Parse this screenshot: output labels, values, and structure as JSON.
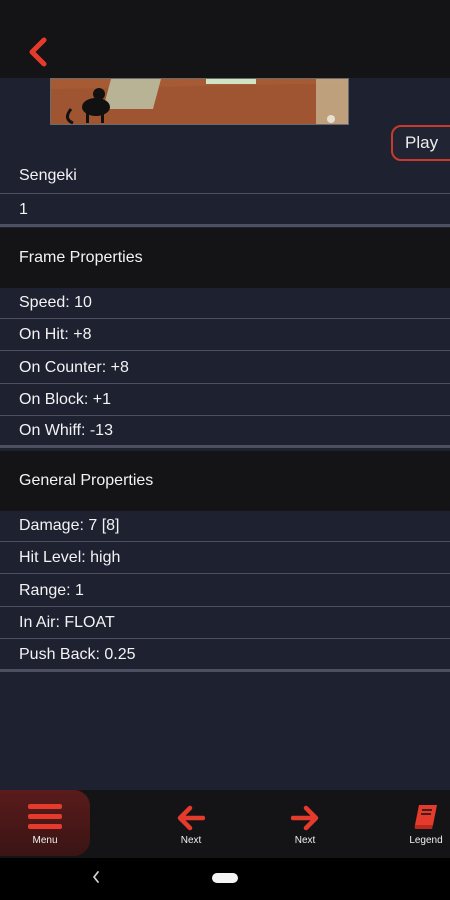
{
  "header": {
    "play_label": "Play"
  },
  "move": {
    "name": "Sengeki",
    "number": "1"
  },
  "frame_properties": {
    "title": "Frame Properties",
    "items": [
      "Speed: 10",
      "On Hit: +8",
      "On Counter: +8",
      "On Block: +1",
      "On Whiff: -13"
    ]
  },
  "general_properties": {
    "title": "General Properties",
    "items": [
      "Damage: 7 [8]",
      "Hit Level: high",
      "Range: 1",
      "In Air: FLOAT",
      "Push Back: 0.25"
    ]
  },
  "bottom_nav": {
    "menu": "Menu",
    "prev": "Next",
    "next": "Next",
    "legend": "Legend"
  },
  "colors": {
    "accent": "#e53b2c",
    "background": "#1d2130",
    "bar": "#141416"
  }
}
